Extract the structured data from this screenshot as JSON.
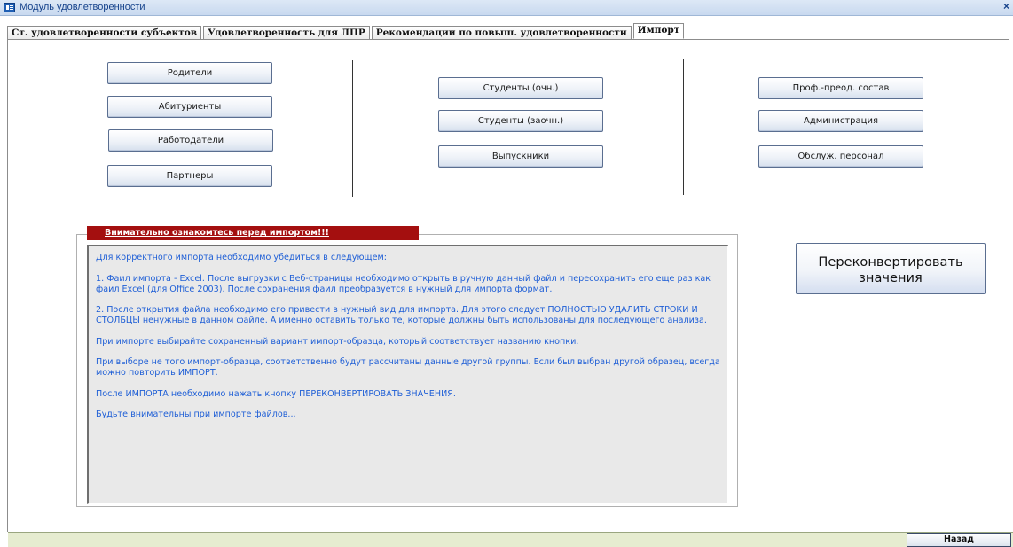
{
  "window": {
    "title": "Модуль удовлетворенности",
    "close_label": "×"
  },
  "tabs": [
    {
      "label": "Ст. удовлетворенности субъектов"
    },
    {
      "label": "Удовлетворенность для ЛПР"
    },
    {
      "label": "Рекомендации по повыш. удовлетворенности"
    },
    {
      "label": "Импорт"
    }
  ],
  "import_buttons": {
    "col1": [
      "Родители",
      "Абитуриенты",
      "Работодатели",
      "Партнеры"
    ],
    "col2": [
      "Студенты (очн.)",
      "Студенты (заочн.)",
      "Выпускники"
    ],
    "col3": [
      "Проф.-преод. состав",
      "Администрация",
      "Обслуж. персонал"
    ]
  },
  "notice": {
    "heading": "Внимательно ознакомтесь перед импортом!!!",
    "paragraphs": [
      "Для корректного импорта необходимо убедиться в следующем:",
      "1. Фаил импорта - Excel. После выгрузки с Веб-страницы необходимо открыть в ручную данный файл и пересохранить его еще раз как фаил Excel (для Office 2003). После сохранения фаил преобразуется в нужный для импорта формат.",
      "2. После открытия файла необходимо его привести в нужный вид для импорта. Для этого следует ПОЛНОСТЬЮ УДАЛИТЬ СТРОКИ И СТОЛБЦЫ ненужные в данном файле. А именно оставить только те, которые должны быть использованы для последующего анализа.",
      "При импорте выбирайте сохраненный вариант импорт-образца, который соответствует названию кнопки.",
      "При выборе не того импорт-образца, соответственно будут рассчитаны данные другой группы. Если был выбран другой образец, всегда можно повторить ИМПОРТ.",
      "После ИМПОРТА необходимо нажать кнопку ПЕРЕКОНВЕРТИРОВАТЬ ЗНАЧЕНИЯ.",
      "Будьте внимательны при импорте файлов..."
    ]
  },
  "reconvert_button": {
    "line1": "Переконвертировать",
    "line2": "значения"
  },
  "back_button": "Назад",
  "colors": {
    "warning_red": "#a40f0f",
    "notice_text": "#1f5fd6",
    "status_bar": "#e6ecd0"
  }
}
